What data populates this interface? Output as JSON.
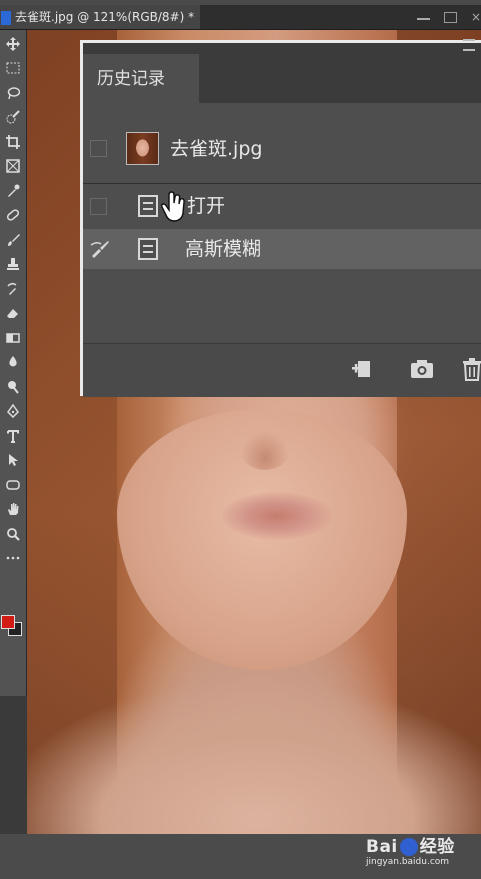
{
  "document_tab": {
    "title": "去雀斑.jpg @ 121%(RGB/8#) *",
    "close": "×"
  },
  "window_controls": {
    "close": "×"
  },
  "tools": [
    {
      "icon": "move-icon"
    },
    {
      "icon": "marquee-icon"
    },
    {
      "icon": "lasso-icon"
    },
    {
      "icon": "quick-select-icon"
    },
    {
      "icon": "crop-icon"
    },
    {
      "icon": "frame-icon"
    },
    {
      "icon": "eyedropper-icon"
    },
    {
      "icon": "healing-icon"
    },
    {
      "icon": "brush-icon"
    },
    {
      "icon": "stamp-icon"
    },
    {
      "icon": "history-brush-icon"
    },
    {
      "icon": "eraser-icon"
    },
    {
      "icon": "gradient-icon"
    },
    {
      "icon": "blur-icon"
    },
    {
      "icon": "dodge-icon"
    },
    {
      "icon": "pen-icon"
    },
    {
      "icon": "type-icon",
      "glyph": "T"
    },
    {
      "icon": "path-select-icon"
    },
    {
      "icon": "shape-icon"
    },
    {
      "icon": "hand-icon"
    },
    {
      "icon": "zoom-icon"
    },
    {
      "icon": "more-tools-icon",
      "glyph": "•••"
    }
  ],
  "colors": {
    "foreground": "#d21b14",
    "background": "#222222"
  },
  "history_panel": {
    "tab_label": "历史记录",
    "snapshot_label": "去雀斑.jpg",
    "states": [
      {
        "label": "打开",
        "selected": false
      },
      {
        "label": "高斯模糊",
        "selected": true
      }
    ]
  },
  "watermark": {
    "logo": "Bai",
    "logo2": "经验",
    "url": "jingyan.baidu.com"
  }
}
